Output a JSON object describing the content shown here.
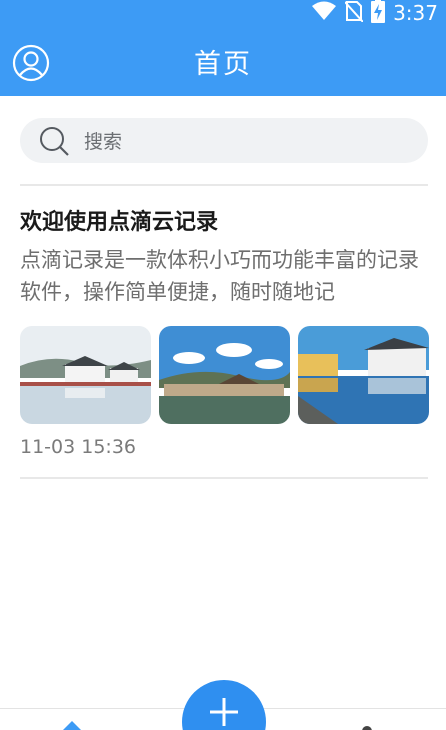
{
  "status_bar": {
    "time": "3:37",
    "icons": [
      "wifi-icon",
      "no-sim-icon",
      "battery-charging-icon"
    ]
  },
  "header": {
    "title": "首页",
    "profile_icon": "user-circle-icon",
    "background": "#3d9bf5"
  },
  "search": {
    "placeholder": "搜索",
    "icon": "search-icon"
  },
  "notes": [
    {
      "title": "欢迎使用点滴云记录",
      "body": "点滴记录是一款体积小巧而功能丰富的记录软件，操作简单便捷，随时随地记",
      "images": [
        "village-lake-photo",
        "town-riverside-photo",
        "village-reflection-photo"
      ],
      "time": "11-03 15:36"
    }
  ],
  "bottom_nav": {
    "fab_icon": "plus-icon",
    "home_icon": "home-icon",
    "mine_icon": "person-icon",
    "accent": "#2f8ff0"
  }
}
